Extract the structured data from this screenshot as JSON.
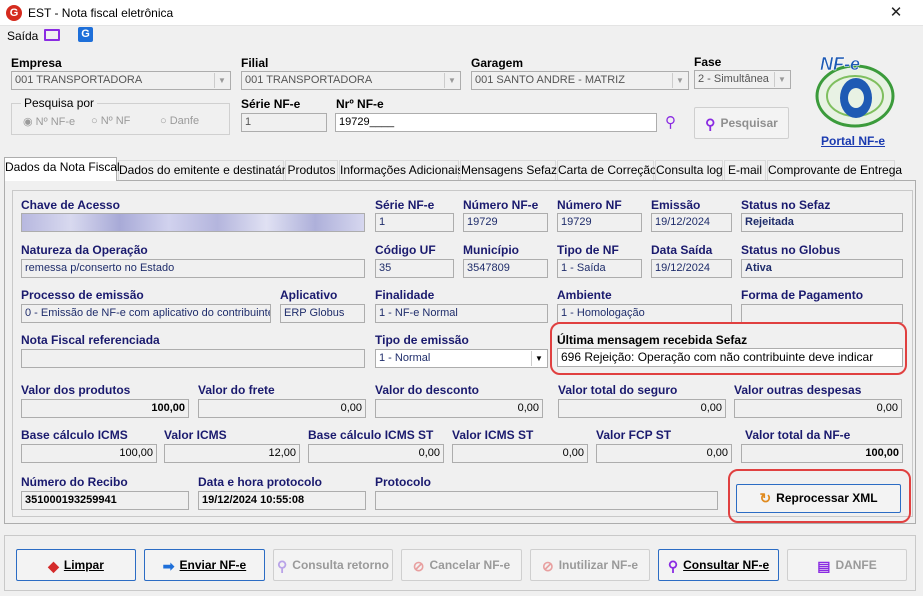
{
  "window": {
    "title": "EST - Nota fiscal eletrônica",
    "close": "✕"
  },
  "menu": {
    "saida_label": "Saída"
  },
  "empresa": {
    "label": "Empresa",
    "value": "001 TRANSPORTADORA"
  },
  "filial": {
    "label": "Filial",
    "value": "001 TRANSPORTADORA"
  },
  "garagem": {
    "label": "Garagem",
    "value": "001 SANTO ANDRE - MATRIZ"
  },
  "fase": {
    "label": "Fase",
    "value": "2 - Simultânea"
  },
  "pesquisa": {
    "label": "Pesquisa por",
    "options": [
      "Nº NF-e",
      "Nº NF",
      "Danfe"
    ]
  },
  "serie_top": {
    "label": "Série NF-e",
    "value": "1"
  },
  "numero_top": {
    "label": "Nrº NF-e",
    "value": "19729____"
  },
  "pesquisar_button": "Pesquisar",
  "portal": {
    "logo_text": "NF-e",
    "link": "Portal NF-e"
  },
  "tabs": [
    "Dados da Nota Fiscal",
    "Dados do emitente e destinatário",
    "Produtos",
    "Informações Adicionais",
    "Mensagens Sefaz",
    "Carta de Correção",
    "Consulta log",
    "E-mail",
    "Comprovante de Entrega"
  ],
  "fields": {
    "chave_acesso": {
      "label": "Chave de Acesso",
      "value": ""
    },
    "serie": {
      "label": "Série NF-e",
      "value": "1"
    },
    "numero_nfe": {
      "label": "Número NF-e",
      "value": "19729"
    },
    "numero_nf": {
      "label": "Número NF",
      "value": "19729"
    },
    "emissao": {
      "label": "Emissão",
      "value": "19/12/2024"
    },
    "status_sefaz": {
      "label": "Status no Sefaz",
      "value": "Rejeitada"
    },
    "natureza": {
      "label": "Natureza da Operação",
      "value": "remessa p/conserto no Estado"
    },
    "codigo_uf": {
      "label": "Código UF",
      "value": "35"
    },
    "municipio": {
      "label": "Município",
      "value": "3547809"
    },
    "tipo_nf": {
      "label": "Tipo de NF",
      "value": "1 - Saída"
    },
    "data_saida": {
      "label": "Data Saída",
      "value": "19/12/2024"
    },
    "status_globus": {
      "label": "Status no Globus",
      "value": "Ativa"
    },
    "processo": {
      "label": "Processo de emissão",
      "value": "0 - Emissão de NF-e com aplicativo do contribuinte"
    },
    "aplicativo": {
      "label": "Aplicativo",
      "value": "ERP Globus"
    },
    "finalidade": {
      "label": "Finalidade",
      "value": "1 - NF-e Normal"
    },
    "ambiente": {
      "label": "Ambiente",
      "value": "1 - Homologação"
    },
    "forma_pagamento": {
      "label": "Forma de Pagamento",
      "value": ""
    },
    "nf_referenciada": {
      "label": "Nota Fiscal referenciada",
      "value": ""
    },
    "tipo_emissao": {
      "label": "Tipo de emissão",
      "value": "1 - Normal"
    },
    "ultima_mensagem": {
      "label": "Última mensagem recebida Sefaz",
      "value": "696 Rejeição: Operação com não contribuinte deve indicar"
    },
    "valor_produtos": {
      "label": "Valor dos produtos",
      "value": "100,00"
    },
    "valor_frete": {
      "label": "Valor do frete",
      "value": "0,00"
    },
    "valor_desconto": {
      "label": "Valor do desconto",
      "value": "0,00"
    },
    "valor_seguro": {
      "label": "Valor total do seguro",
      "value": "0,00"
    },
    "valor_outras": {
      "label": "Valor outras despesas",
      "value": "0,00"
    },
    "base_icms": {
      "label": "Base cálculo ICMS",
      "value": "100,00"
    },
    "valor_icms": {
      "label": "Valor ICMS",
      "value": "12,00"
    },
    "base_icms_st": {
      "label": "Base cálculo ICMS ST",
      "value": "0,00"
    },
    "valor_icms_st": {
      "label": "Valor ICMS ST",
      "value": "0,00"
    },
    "valor_fcp_st": {
      "label": "Valor FCP ST",
      "value": "0,00"
    },
    "valor_total": {
      "label": "Valor total da NF-e",
      "value": "100,00"
    },
    "numero_recibo": {
      "label": "Número do Recibo",
      "value": "351000193259941"
    },
    "data_protocolo": {
      "label": "Data e hora protocolo",
      "value": "19/12/2024 10:55:08"
    },
    "protocolo": {
      "label": "Protocolo",
      "value": ""
    }
  },
  "reprocessar_button": "Reprocessar XML",
  "footer_buttons": {
    "limpar": "Limpar",
    "enviar": "Enviar NF-e",
    "consulta_retorno": "Consulta retorno",
    "cancelar": "Cancelar NF-e",
    "inutilizar": "Inutilizar NF-e",
    "consultar": "Consultar NF-e",
    "danfe": "DANFE"
  },
  "colors": {
    "label": "#1a1a6e",
    "highlight": "#e04040",
    "accent": "#2b6cc4"
  }
}
